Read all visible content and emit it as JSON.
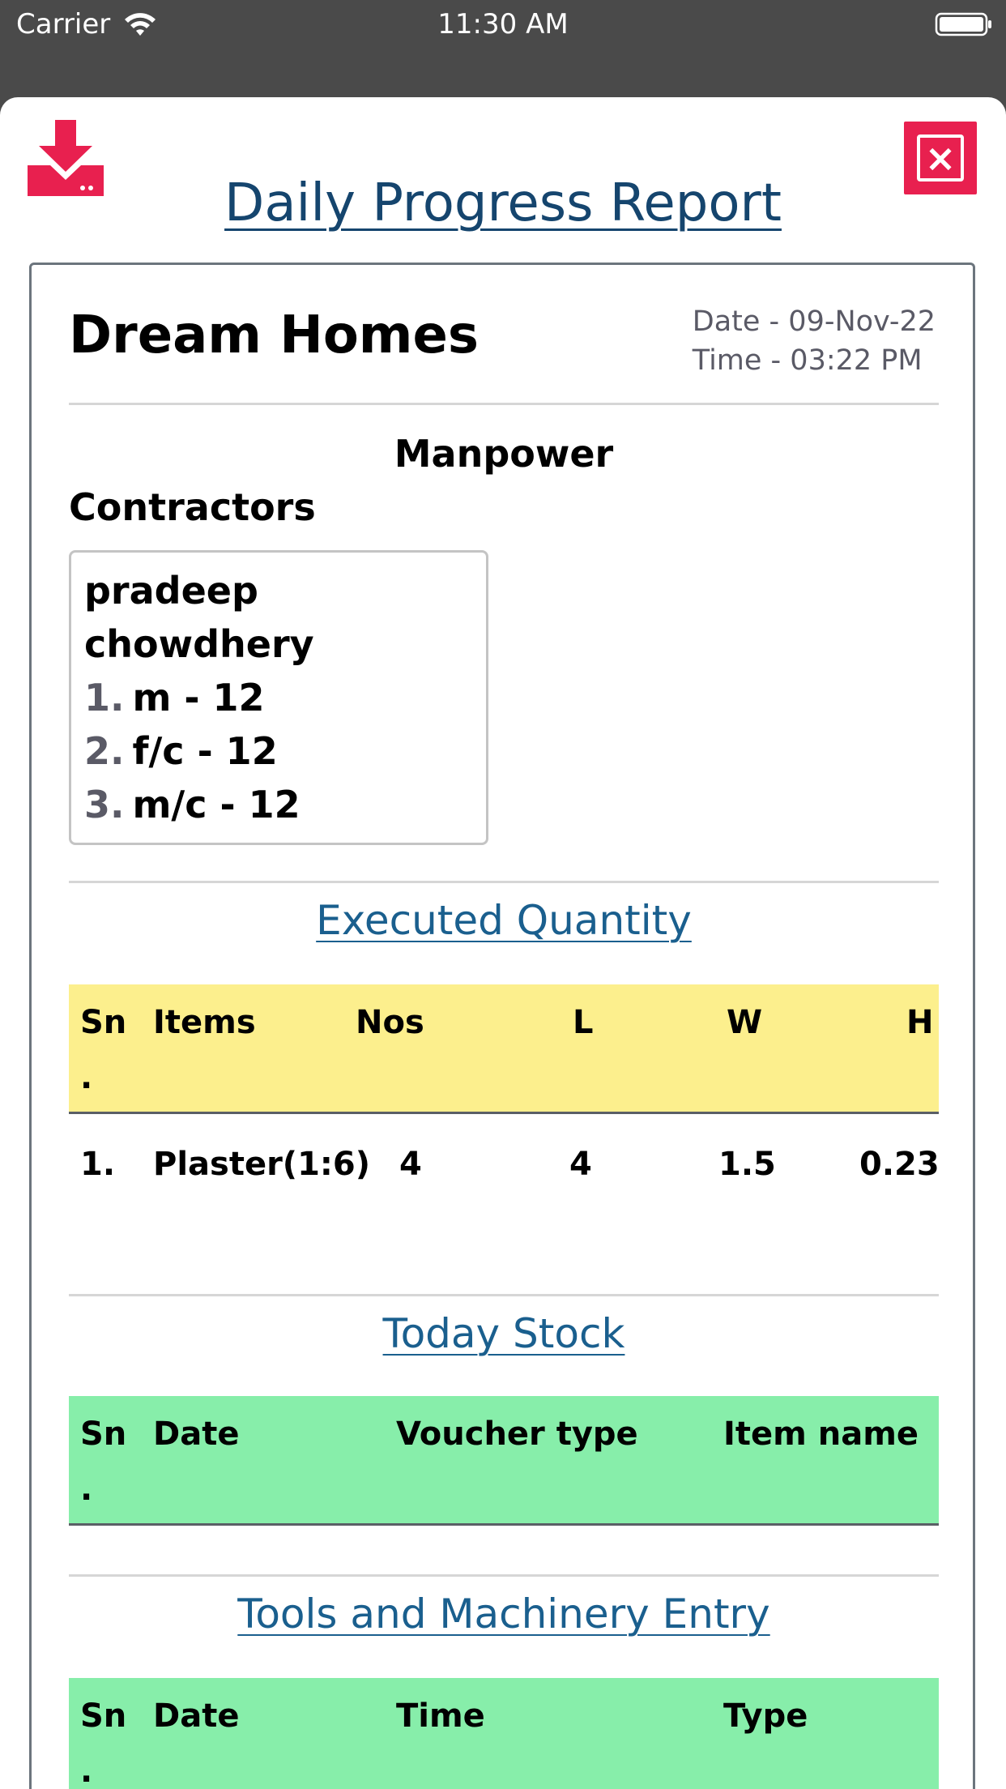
{
  "status_bar": {
    "carrier": "Carrier",
    "time": "11:30 AM"
  },
  "modal": {
    "title": "Daily Progress Report",
    "download_icon": "download-icon",
    "close_icon": "close-icon",
    "accent_color": "#e8204f",
    "title_color": "#15456e"
  },
  "report": {
    "project_name": "Dream Homes",
    "date": "Date - 09-Nov-22",
    "time": "Time - 03:22 PM",
    "manpower_title": "Manpower",
    "contractors_label": "Contractors",
    "contractor": {
      "name": "pradeep chowdhery",
      "items": [
        {
          "num": "1.",
          "text": "m  - 12"
        },
        {
          "num": "2.",
          "text": "f/c  - 12"
        },
        {
          "num": "3.",
          "text": "m/c  - 12"
        }
      ]
    },
    "executed_quantity": {
      "title": "Executed Quantity",
      "header_color": "#fcef8d",
      "headers": {
        "sn": "Sn",
        "sn_dot": ".",
        "items": "Items",
        "nos": "Nos",
        "l": "L",
        "w": "W",
        "h": "H"
      },
      "rows": [
        {
          "sn": "1.",
          "item": "Plaster(1:6)",
          "nos": "4",
          "l": "4",
          "w": "1.5",
          "h": "0.23"
        }
      ]
    },
    "today_stock": {
      "title": "Today Stock",
      "header_color": "#87eeaa",
      "headers": {
        "sn": "Sn",
        "sn_dot": ".",
        "date": "Date",
        "voucher_type": "Voucher type",
        "item_name": "Item name"
      }
    },
    "tools_machinery": {
      "title": "Tools and Machinery Entry",
      "header_color": "#87eeaa",
      "headers": {
        "sn": "Sn",
        "sn_dot": ".",
        "date": "Date",
        "time": "Time",
        "type": "Type"
      }
    }
  }
}
